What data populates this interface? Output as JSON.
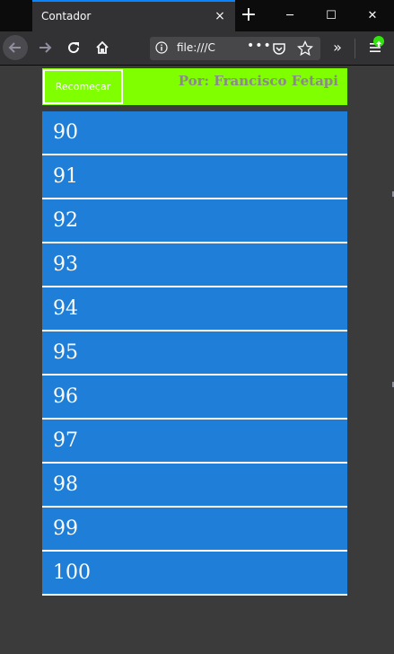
{
  "browser": {
    "tab_title": "Contador",
    "tab_close_icon": "×",
    "new_tab_icon": "+",
    "window_minimize_icon": "─",
    "window_maximize_icon": "☐",
    "window_close_icon": "✕",
    "url": "file:///C",
    "url_more_icon": "•••",
    "overflow_icon": "»"
  },
  "page": {
    "restart_label": "Recomeçar",
    "author": "Por: Francisco Fetapi",
    "numbers": [
      "90",
      "91",
      "92",
      "93",
      "94",
      "95",
      "96",
      "97",
      "98",
      "99",
      "100"
    ]
  },
  "colors": {
    "header_bg": "#7fff00",
    "item_bg": "#1f7fd8",
    "page_bg": "#3b3b3b"
  }
}
